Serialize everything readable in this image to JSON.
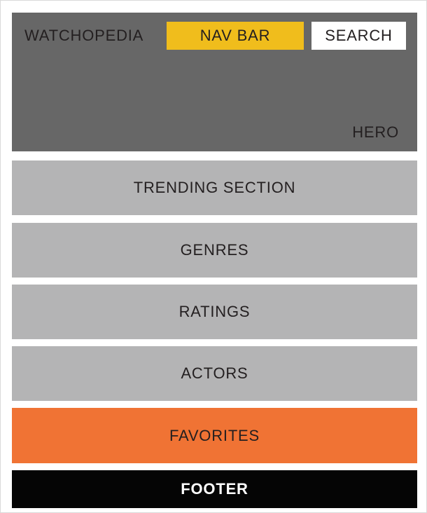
{
  "hero": {
    "brand": "WATCHOPEDIA",
    "nav_bar": "NAV BAR",
    "search": "SEARCH",
    "label": "HERO"
  },
  "sections": {
    "trending": "TRENDING SECTION",
    "genres": "GENRES",
    "ratings": "RATINGS",
    "actors": "ACTORS",
    "favorites": "FAVORITES",
    "footer": "FOOTER"
  },
  "colors": {
    "hero": "#676767",
    "nav_bar": "#f0bd1c",
    "section": "#b4b4b5",
    "favorites": "#f07334",
    "footer": "#050505"
  }
}
